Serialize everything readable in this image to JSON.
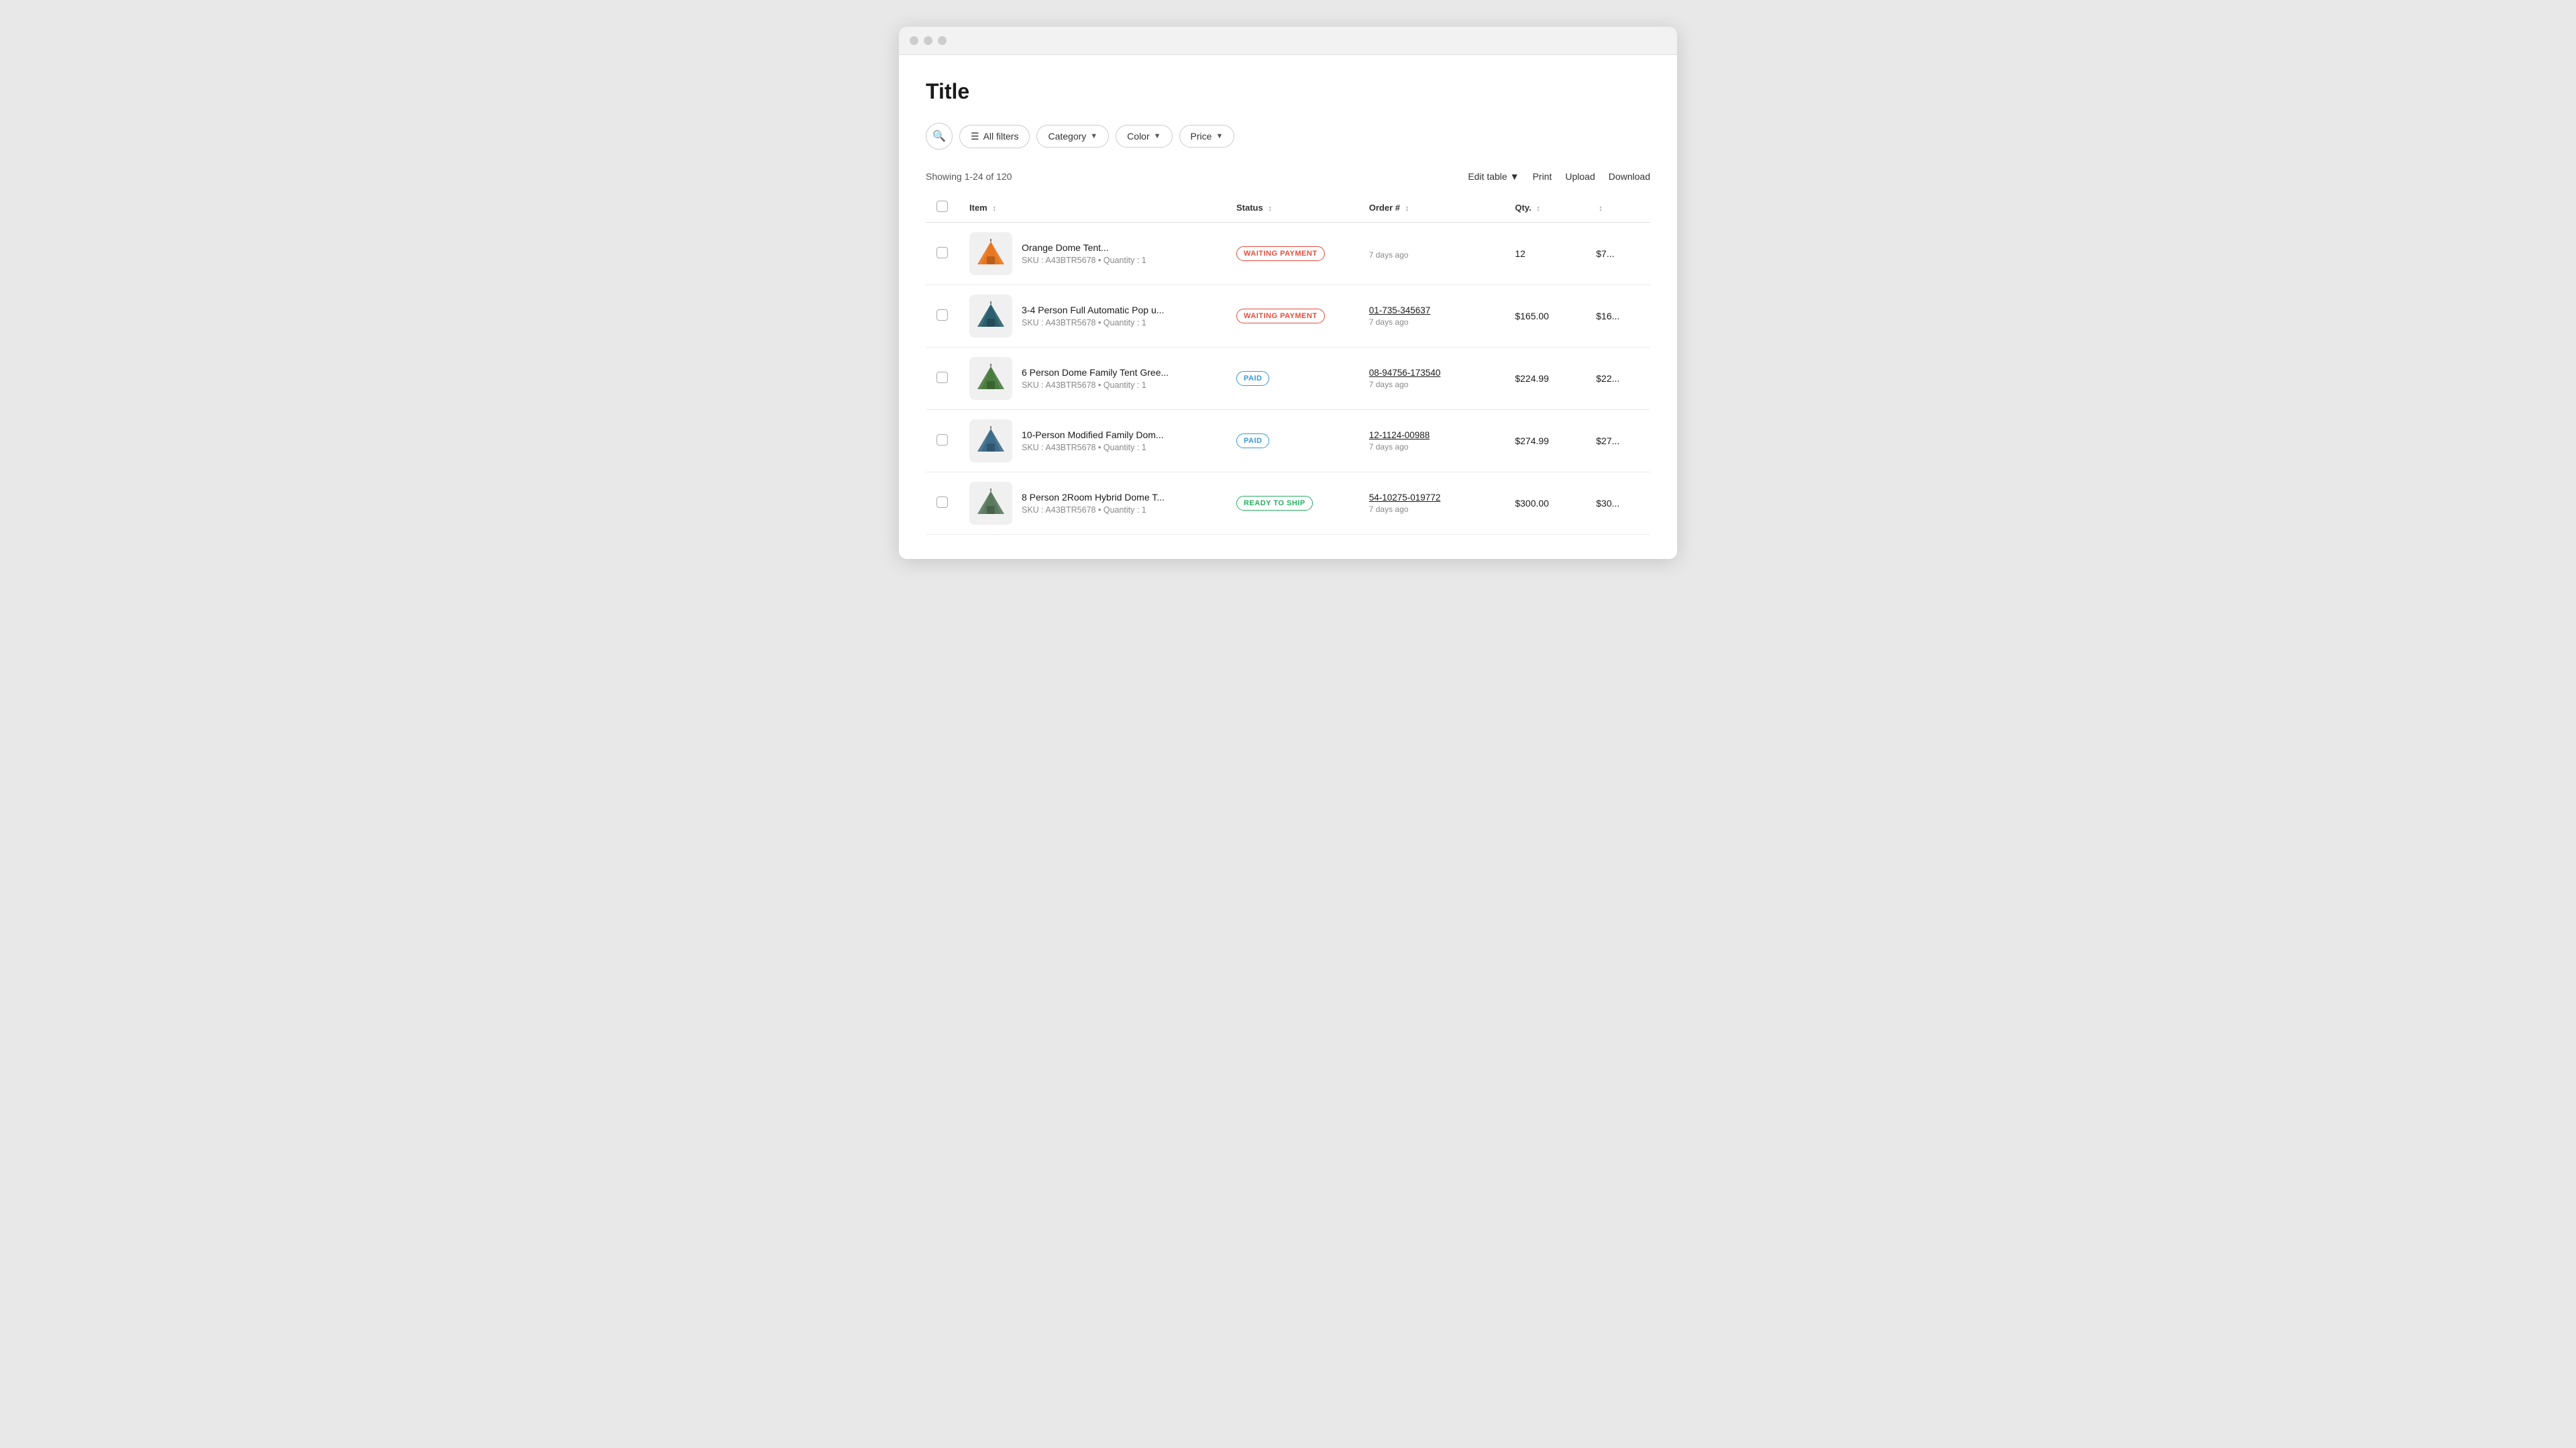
{
  "page": {
    "title": "Title",
    "showing_text": "Showing 1-24 of 120"
  },
  "filters": {
    "search_label": "Search",
    "all_filters_label": "All filters",
    "category_label": "Category",
    "color_label": "Color",
    "price_label": "Price"
  },
  "table_actions": {
    "edit_table": "Edit table",
    "print": "Print",
    "upload": "Upload",
    "download": "Download"
  },
  "columns": [
    {
      "id": "item",
      "label": "Item"
    },
    {
      "id": "status",
      "label": "Status"
    },
    {
      "id": "order",
      "label": "Order #"
    },
    {
      "id": "qty",
      "label": "Qty."
    }
  ],
  "rows": [
    {
      "id": "row-0",
      "item_name": "Orange Dome Tent...",
      "item_sku": "SKU : A43BTR5678",
      "item_qty_meta": "Quantity : 1",
      "status": "WAITING PAYMENT",
      "status_type": "waiting",
      "order_num": null,
      "order_date": "7 days ago",
      "qty": "12",
      "price": "$7...",
      "image_color": "#e87722",
      "image_type": "tent-orange"
    },
    {
      "id": "row-1",
      "item_name": "3-4 Person Full Automatic Pop u...",
      "item_sku": "SKU : A43BTR5678",
      "item_qty_meta": "Quantity : 1",
      "status": "WAITING PAYMENT",
      "status_type": "waiting",
      "order_num": "01-735-345637",
      "order_date": "7 days ago",
      "qty": "$165.00",
      "price": "$16...",
      "image_color": "#2c5f6e",
      "image_type": "tent-dark"
    },
    {
      "id": "row-2",
      "item_name": "6 Person Dome Family Tent Gree...",
      "item_sku": "SKU : A43BTR5678",
      "item_qty_meta": "Quantity : 1",
      "status": "PAID",
      "status_type": "paid",
      "order_num": "08-94756-173540",
      "order_date": "7 days ago",
      "qty": "$224.99",
      "price": "$22...",
      "image_color": "#4a7c3f",
      "image_type": "tent-green"
    },
    {
      "id": "row-3",
      "item_name": "10-Person Modified Family Dom...",
      "item_sku": "SKU : A43BTR5678",
      "item_qty_meta": "Quantity : 1",
      "status": "PAID",
      "status_type": "paid",
      "order_num": "12-1124-00988",
      "order_date": "7 days ago",
      "qty": "$274.99",
      "price": "$27...",
      "image_color": "#3d6b8a",
      "image_type": "tent-blue"
    },
    {
      "id": "row-4",
      "item_name": "8 Person 2Room Hybrid Dome T...",
      "item_sku": "SKU : A43BTR5678",
      "item_qty_meta": "Quantity : 1",
      "status": "READY TO SHIP",
      "status_type": "ready",
      "order_num": "54-10275-019772",
      "order_date": "7 days ago",
      "qty": "$300.00",
      "price": "$30...",
      "image_color": "#5a7a5e",
      "image_type": "tent-grey"
    }
  ]
}
